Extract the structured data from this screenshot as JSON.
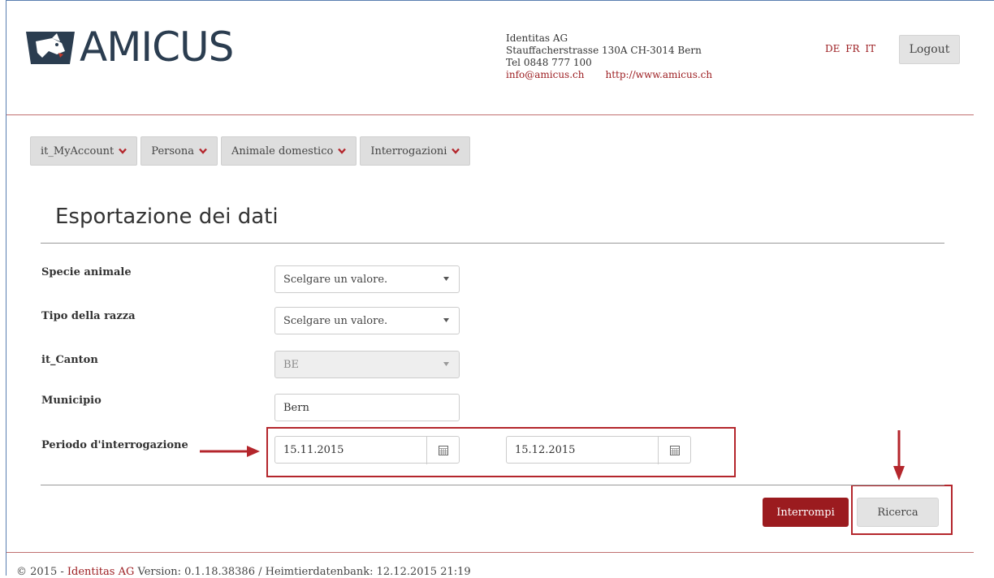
{
  "brand": {
    "name": "AMICUS"
  },
  "company": {
    "name": "Identitas AG",
    "address": "Stauffacherstrasse 130A CH-3014 Bern",
    "phone": "Tel 0848 777 100",
    "email": "info@amicus.ch",
    "website": "http://www.amicus.ch"
  },
  "lang": {
    "de": "DE",
    "fr": "FR",
    "it": "IT"
  },
  "logout_label": "Logout",
  "nav": [
    {
      "label": "it_MyAccount"
    },
    {
      "label": "Persona"
    },
    {
      "label": "Animale domestico"
    },
    {
      "label": "Interrogazioni"
    }
  ],
  "page_title": "Esportazione dei dati",
  "form": {
    "species": {
      "label": "Specie animale",
      "value": "Scelgare un valore."
    },
    "breed_type": {
      "label": "Tipo della razza",
      "value": "Scelgare un valore."
    },
    "canton": {
      "label": "it_Canton",
      "value": "BE"
    },
    "municipality": {
      "label": "Municipio",
      "value": "Bern"
    },
    "period": {
      "label": "Periodo d'interrogazione",
      "from": "15.11.2015",
      "to": "15.12.2015"
    }
  },
  "buttons": {
    "cancel": "Interrompi",
    "search": "Ricerca"
  },
  "footer": {
    "prefix": "© 2015 -",
    "company_link": "Identitas AG",
    "version": "Version: 0.1.18.38386 / Heimtierdatenbank: 12.12.2015 21:19"
  },
  "colors": {
    "accent": "#9b1b1f",
    "annotation": "#b4262c",
    "logo": "#2b3d50"
  }
}
